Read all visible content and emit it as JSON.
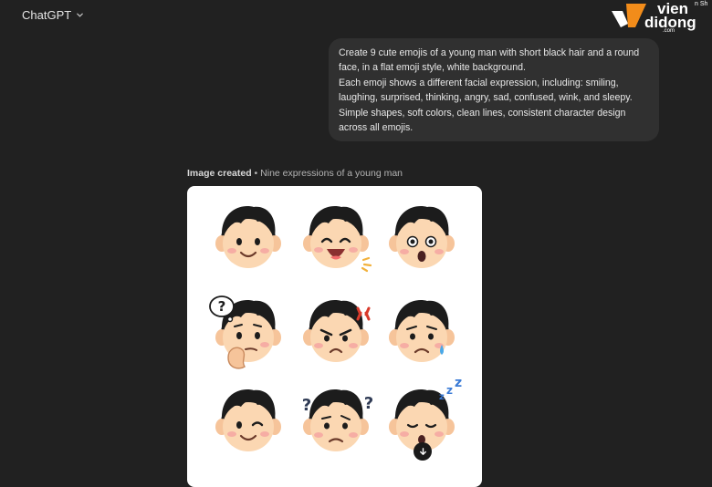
{
  "header": {
    "model_label": "ChatGPT"
  },
  "watermark": {
    "line1": "vien",
    "line2": "didong",
    "suffix": ".com",
    "small": "n Sh"
  },
  "user_message": {
    "lines": [
      "Create 9 cute emojis of a young man with short black hair and a round",
      "face, in a flat emoji style, white background.",
      "Each emoji shows a different facial expression, including: smiling,",
      "laughing, surprised, thinking, angry, sad, confused, wink, and sleepy.",
      "Simple shapes, soft colors, clean lines, consistent character design",
      "across all emojis."
    ]
  },
  "image_result": {
    "status_label": "Image created",
    "separator": "•",
    "title": "Nine expressions of a young man",
    "emojis": [
      "smiling",
      "laughing",
      "surprised",
      "thinking",
      "angry",
      "sad",
      "wink",
      "confused",
      "sleepy"
    ]
  },
  "icons": {
    "chevron": "chevron-down-icon",
    "download": "download-icon"
  },
  "colors": {
    "background": "#212121",
    "bubble": "#303030",
    "skin": "#fbd7b2",
    "hair": "#1c1c1c",
    "logo_orange": "#f28c1a"
  }
}
